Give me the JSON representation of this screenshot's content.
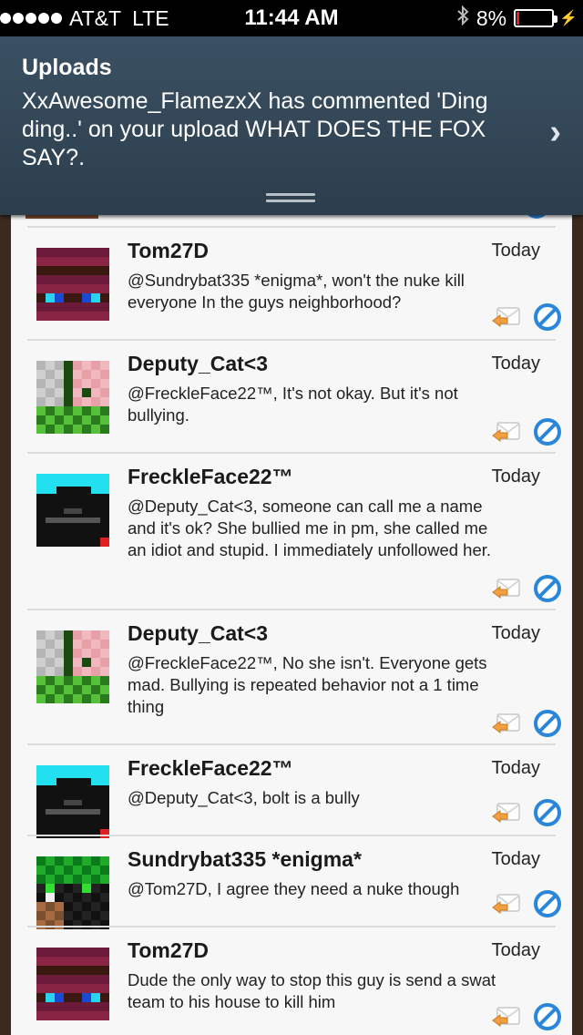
{
  "status_bar": {
    "carrier": "AT&T",
    "network": "LTE",
    "time": "11:44 AM",
    "battery_percent": "8%",
    "battery_level": 0.08,
    "signal_dots": 5
  },
  "notification": {
    "title": "Uploads",
    "message": "XxAwesome_FlamezxX has commented 'Ding ding..' on your upload WHAT DOES THE FOX SAY?."
  },
  "comments": [
    {
      "username": "Tom27D",
      "time": "Today",
      "text": "@Sundrybat335 *enigma*, won't the nuke kill everyone In the guys neighborhood?",
      "avatar": "tom-avatar"
    },
    {
      "username": "Deputy_Cat<3",
      "time": "Today",
      "text": "@FreckleFace22™, It's not okay. But it's not bullying.",
      "avatar": "deputy-avatar"
    },
    {
      "username": "FreckleFace22™",
      "time": "Today",
      "text": "@Deputy_Cat<3, someone can call me a name and it's ok? She bullied me in pm, she called me an idiot and stupid. I immediately unfollowed her.",
      "avatar": "freckle-avatar"
    },
    {
      "username": "Deputy_Cat<3",
      "time": "Today",
      "text": "@FreckleFace22™, No she isn't. Everyone gets mad. Bullying is repeated behavior not a 1 time thing",
      "avatar": "deputy-avatar"
    },
    {
      "username": "FreckleFace22™",
      "time": "Today",
      "text": "@Deputy_Cat<3, bolt is a bully",
      "avatar": "freckle-avatar"
    },
    {
      "username": "Sundrybat335 *enigma*",
      "time": "Today",
      "text": "@Tom27D, I agree they need a nuke though",
      "avatar": "sundry-avatar"
    },
    {
      "username": "Tom27D",
      "time": "Today",
      "text": "Dude the only way to stop this guy is send a swat team to his house to kill him",
      "avatar": "tom-avatar"
    }
  ],
  "colors": {
    "banner": "#34495a",
    "panel": "#f7f7f7",
    "reply_icon": "#f0a040",
    "block_icon": "#2a86d8"
  }
}
